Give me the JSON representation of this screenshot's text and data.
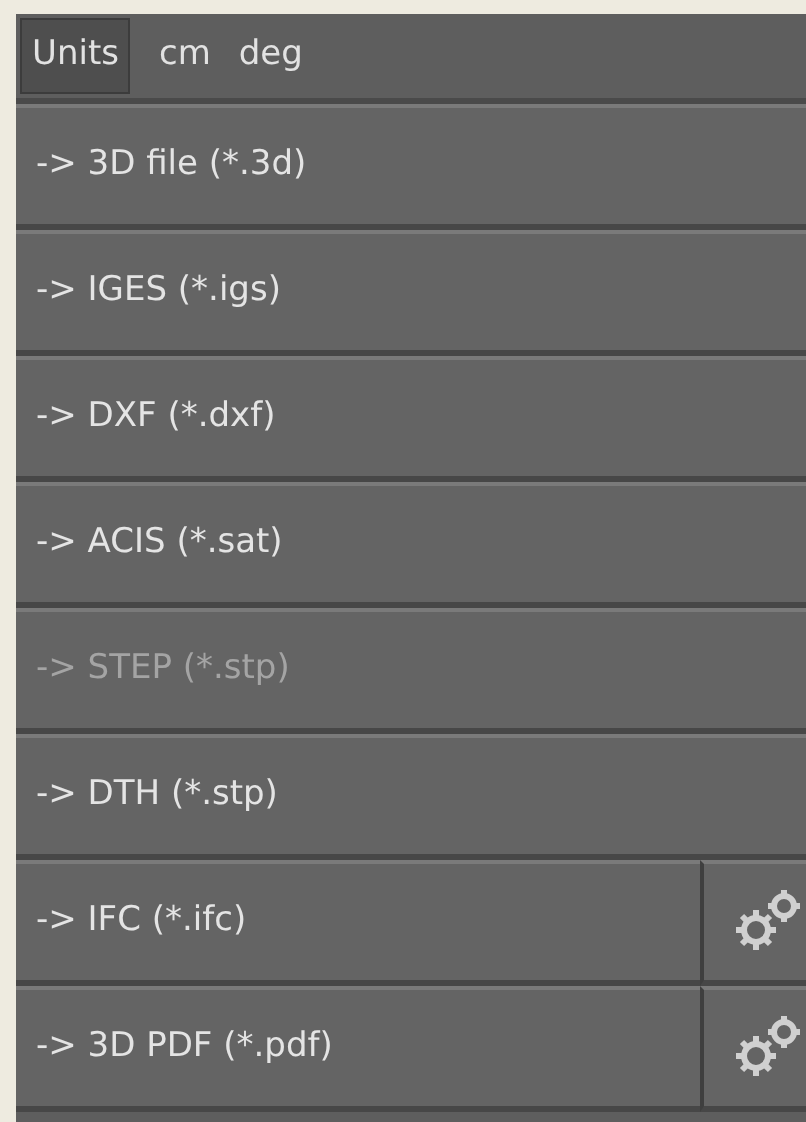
{
  "units_bar": {
    "label": "Units",
    "length_unit": "cm",
    "angle_unit": "deg"
  },
  "export_buttons": [
    {
      "label": "-> 3D file (*.3d)",
      "disabled": false,
      "settings": false
    },
    {
      "label": "-> IGES (*.igs)",
      "disabled": false,
      "settings": false
    },
    {
      "label": "-> DXF (*.dxf)",
      "disabled": false,
      "settings": false
    },
    {
      "label": "-> ACIS (*.sat)",
      "disabled": false,
      "settings": false
    },
    {
      "label": "-> STEP (*.stp)",
      "disabled": true,
      "settings": false
    },
    {
      "label": "-> DTH (*.stp)",
      "disabled": false,
      "settings": false
    },
    {
      "label": "-> IFC (*.ifc)",
      "disabled": false,
      "settings": true
    },
    {
      "label": "-> 3D PDF (*.pdf)",
      "disabled": false,
      "settings": true
    }
  ]
}
